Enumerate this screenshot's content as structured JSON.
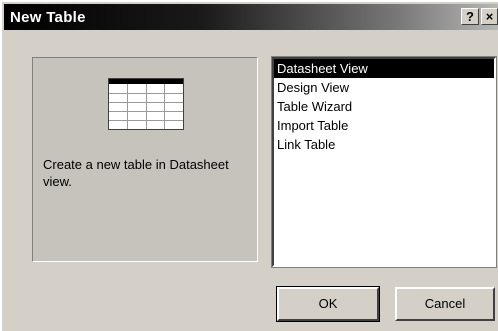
{
  "window": {
    "title": "New Table",
    "help_button": "?",
    "close_button": "×"
  },
  "preview": {
    "icon": "table-grid-icon",
    "description": "Create a new table in Datasheet view."
  },
  "options": {
    "selected_index": 0,
    "items": [
      {
        "label": "Datasheet View"
      },
      {
        "label": "Design View"
      },
      {
        "label": "Table Wizard"
      },
      {
        "label": "Import Table"
      },
      {
        "label": "Link Table"
      }
    ]
  },
  "buttons": {
    "ok": "OK",
    "cancel": "Cancel"
  }
}
